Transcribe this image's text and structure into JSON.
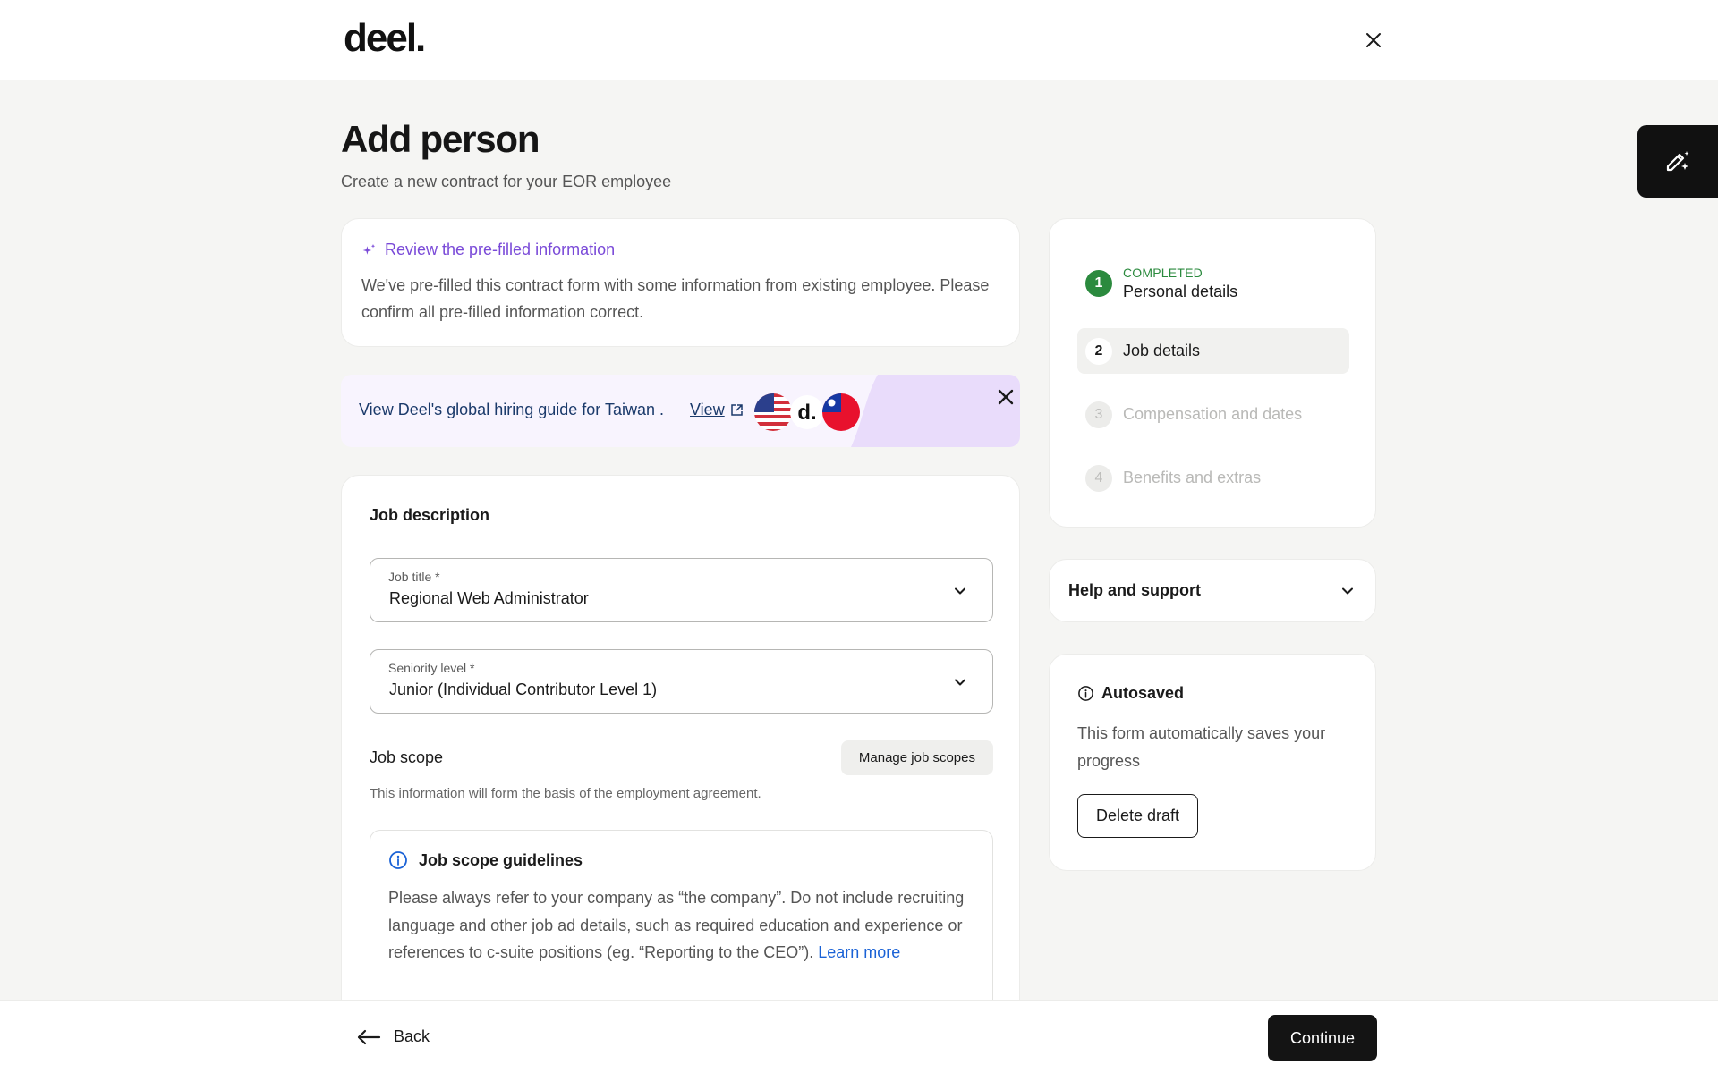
{
  "header": {
    "logo_text": "deel.",
    "close_icon": "close-icon"
  },
  "ai_button": {
    "icon": "magic-pen-icon"
  },
  "page": {
    "title": "Add person",
    "subtitle": "Create a new contract for your EOR employee"
  },
  "prefill_notice": {
    "icon": "sparkle-icon",
    "title": "Review the pre-filled information",
    "body": "We've pre-filled this contract form with some information from existing employee. Please confirm all pre-filled information correct."
  },
  "guide_banner": {
    "text": "View Deel's global hiring guide for Taiwan .",
    "link_label": "View",
    "link_icon": "external-link-icon",
    "brand_letter": "d.",
    "close_icon": "close-icon",
    "accent_color": "#e9dcfb"
  },
  "job_form": {
    "section_title": "Job description",
    "job_title": {
      "label": "Job title *",
      "value": "Regional Web Administrator"
    },
    "seniority": {
      "label": "Seniority level *",
      "value": "Junior (Individual Contributor Level 1)"
    },
    "job_scope": {
      "label": "Job scope",
      "manage_button": "Manage job scopes",
      "help_text": "This information will form the basis of the employment agreement."
    },
    "guidelines": {
      "title": "Job scope guidelines",
      "body": "Please always refer to your company as “the company”. Do not include recruiting language and other job ad details, such as required education and experience or references to c-suite positions (eg. “Reporting to the CEO”).",
      "link": "Learn more"
    }
  },
  "steps": [
    {
      "number": "1",
      "label": "Personal details",
      "status": "COMPLETED",
      "state": "done"
    },
    {
      "number": "2",
      "label": "Job details",
      "status": "",
      "state": "current"
    },
    {
      "number": "3",
      "label": "Compensation and dates",
      "status": "",
      "state": "todo"
    },
    {
      "number": "4",
      "label": "Benefits and extras",
      "status": "",
      "state": "todo"
    }
  ],
  "help_support": {
    "title": "Help and support"
  },
  "autosave": {
    "title": "Autosaved",
    "body": "This form automatically saves your progress",
    "delete_button": "Delete draft"
  },
  "footer": {
    "back_label": "Back",
    "continue_label": "Continue"
  },
  "colors": {
    "completed": "#2b8a3e",
    "accent_purple": "#7a4ad8",
    "link_blue": "#1a62d6",
    "primary_button": "#141414"
  }
}
